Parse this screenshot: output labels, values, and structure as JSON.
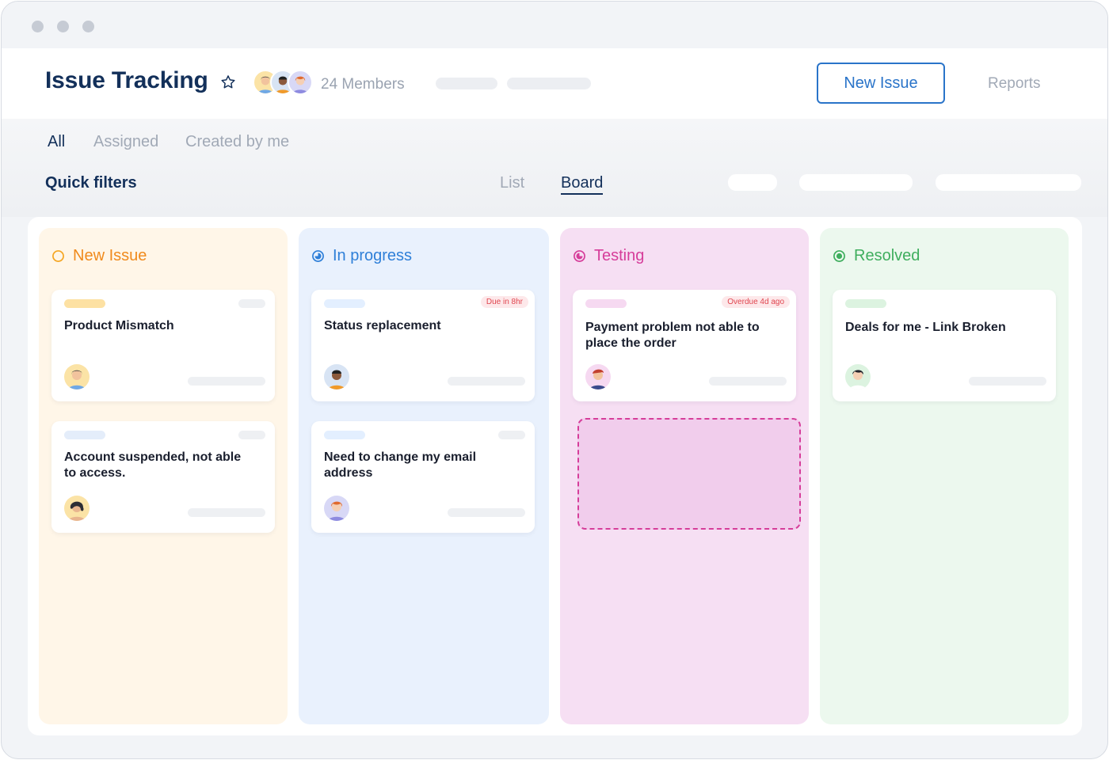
{
  "header": {
    "title": "Issue Tracking",
    "members_label": "24 Members",
    "new_issue_button": "New Issue",
    "reports_link": "Reports"
  },
  "tabs": [
    "All",
    "Assigned",
    "Created by me"
  ],
  "quick_filters": "Quick filters",
  "views": [
    "List",
    "Board"
  ],
  "columns": [
    {
      "title": "New Issue",
      "color": "#f08a1c",
      "background": "#fff6e8",
      "cards": [
        {
          "title": "Product Mismatch",
          "tag_color": "#fde1a3"
        },
        {
          "title": "Account suspended, not able to access.",
          "tag_color": "#e4edfa"
        }
      ]
    },
    {
      "title": "In progress",
      "color": "#2e7fd8",
      "background": "#e9f1fd",
      "cards": [
        {
          "title": "Status replacement",
          "tag_color": "#e3efff",
          "badge": "Due in 8hr"
        },
        {
          "title": "Need to change my email address",
          "tag_color": "#e3efff"
        }
      ]
    },
    {
      "title": "Testing",
      "color": "#d63d9a",
      "background": "#f6dff3",
      "cards": [
        {
          "title": "Payment problem not able to place the order",
          "tag_color": "#f6d9f1",
          "badge": "Overdue 4d ago"
        }
      ]
    },
    {
      "title": "Resolved",
      "color": "#3fae5e",
      "background": "#ecf8ee",
      "cards": [
        {
          "title": "Deals for me - Link Broken",
          "tag_color": "#dcf3e0"
        }
      ]
    }
  ]
}
